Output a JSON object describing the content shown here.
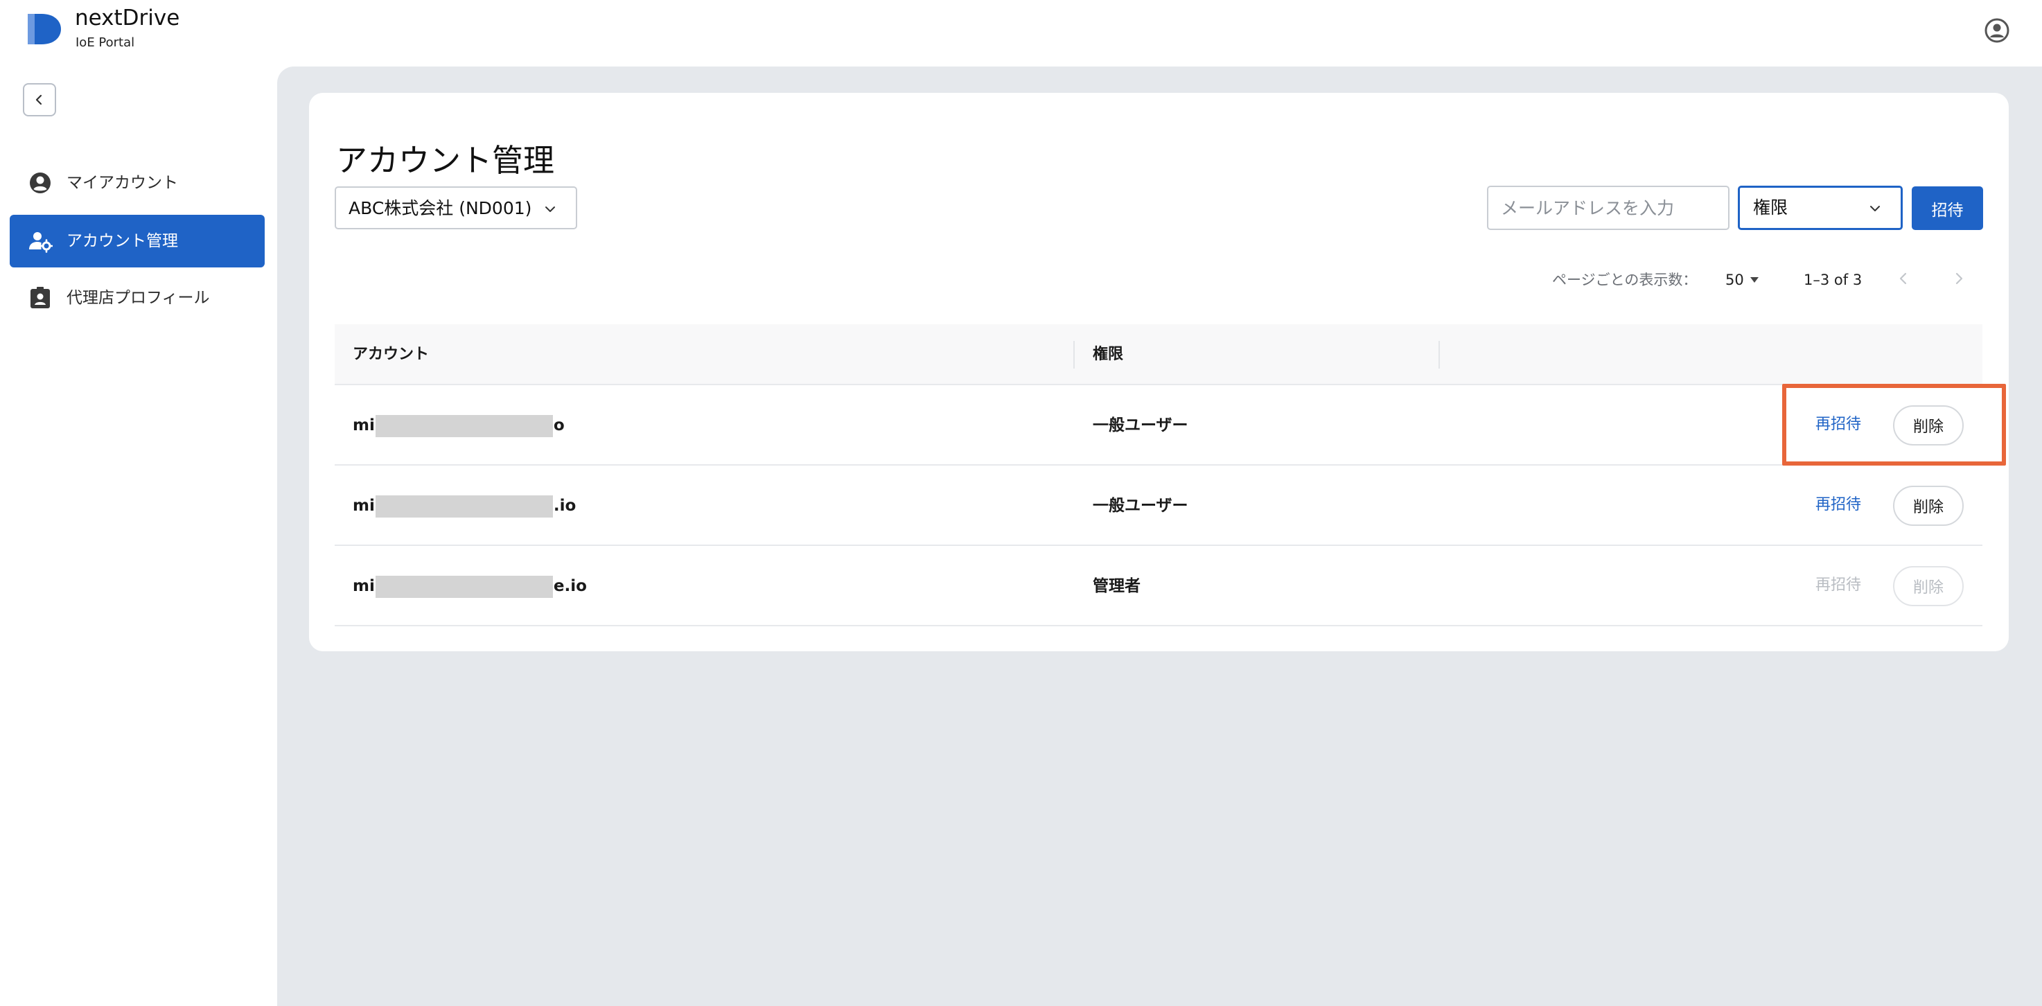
{
  "app": {
    "brand_name": "nextDrive",
    "brand_sub": "IoE Portal"
  },
  "sidebar": {
    "items": [
      {
        "label": "マイアカウント",
        "icon": "account-circle-icon",
        "active": false
      },
      {
        "label": "アカウント管理",
        "icon": "manage-accounts-icon",
        "active": true
      },
      {
        "label": "代理店プロフィール",
        "icon": "contact-badge-icon",
        "active": false
      }
    ]
  },
  "main": {
    "title": "アカウント管理",
    "company_select": {
      "value": "ABC株式会社 (ND001)"
    },
    "email_input": {
      "placeholder": "メールアドレスを入力",
      "value": ""
    },
    "role_select": {
      "value": "権限"
    },
    "invite_label": "招待",
    "pagination": {
      "rows_per_page_label": "ページごとの表示数：",
      "rows_per_page": "50",
      "range": "1–3 of 3"
    },
    "table": {
      "columns": [
        "アカウント",
        "権限"
      ],
      "rows": [
        {
          "account_prefix": "mi",
          "account_suffix": "o",
          "role": "一般ユーザー",
          "reinvite": "再招待",
          "delete": "削除",
          "enabled": true
        },
        {
          "account_prefix": "mi",
          "account_suffix": ".io",
          "role": "一般ユーザー",
          "reinvite": "再招待",
          "delete": "削除",
          "enabled": true
        },
        {
          "account_prefix": "mi",
          "account_suffix": "e.io",
          "role": "管理者",
          "reinvite": "再招待",
          "delete": "削除",
          "enabled": false
        }
      ]
    }
  },
  "colors": {
    "primary": "#1f63c6",
    "highlight": "#e8663a",
    "page_bg": "#e5e8ec"
  }
}
